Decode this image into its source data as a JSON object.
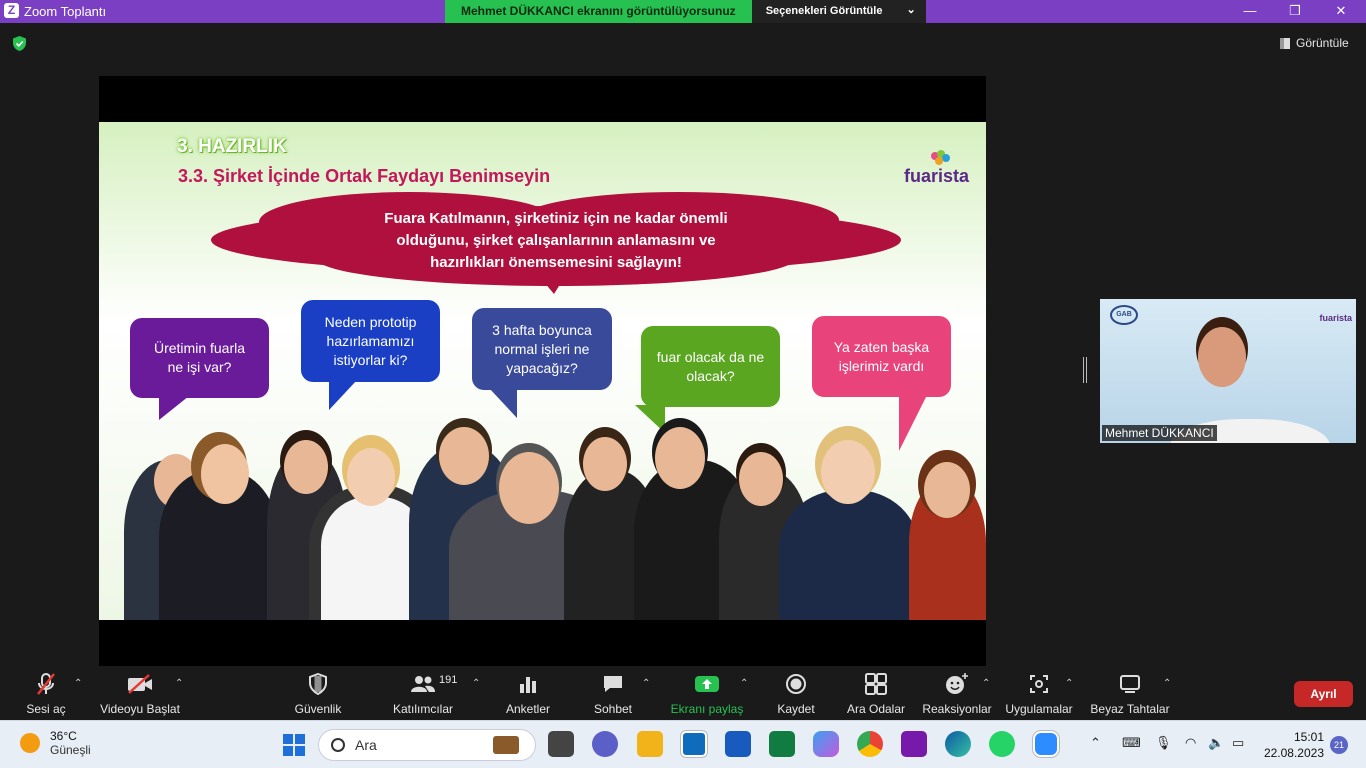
{
  "window": {
    "title": "Zoom Toplantı"
  },
  "share_banner": {
    "message": "Mehmet DÜKKANCI ekranını görüntülüyorsunuz",
    "options_label": "Seçenekleri Görüntüle"
  },
  "view_button": {
    "label": "Görüntüle"
  },
  "slide": {
    "heading": "3. HAZIRLIK",
    "subheading": "3.3. Şirket İçinde Ortak Faydayı Benimseyin",
    "logo_text": "fuarista",
    "cloud_lines": [
      "Fuara Katılmanın, şirketiniz için ne kadar önemli",
      "olduğunu,  şirket çalışanlarının anlamasını ve",
      "hazırlıkları önemsemesini sağlayın!"
    ],
    "bubbles": [
      {
        "lines": [
          "Üretimin fuarla",
          "ne işi var?"
        ],
        "color": "#6a1b9a"
      },
      {
        "lines": [
          "Neden prototip",
          "hazırlamamızı",
          "istiyorlar ki?"
        ],
        "color": "#1a3fc4"
      },
      {
        "lines": [
          "3 hafta boyunca",
          "normal işleri ne",
          "yapacağız?"
        ],
        "color": "#3a4a9a"
      },
      {
        "lines": [
          "fuar olacak da ne",
          "olacak?"
        ],
        "color": "#5aa620"
      },
      {
        "lines": [
          "Ya zaten başka",
          "işlerimiz vardı"
        ],
        "color": "#e8437a"
      }
    ]
  },
  "video": {
    "name": "Mehmet DÜKKANCI",
    "brand": "fuarista",
    "org_logo": "GAB"
  },
  "toolbar": {
    "mute": "Sesi aç",
    "video": "Videoyu Başlat",
    "security": "Güvenlik",
    "participants": "Katılımcılar",
    "participants_count": "191",
    "polls": "Anketler",
    "chat": "Sohbet",
    "share": "Ekranı paylaş",
    "record": "Kaydet",
    "rooms": "Ara Odalar",
    "reactions": "Reaksiyonlar",
    "apps": "Uygulamalar",
    "whiteboard": "Beyaz Tahtalar",
    "leave": "Ayrıl"
  },
  "taskbar": {
    "temp": "36°C",
    "weather": "Güneşli",
    "search_placeholder": "Ara",
    "time": "15:01",
    "date": "22.08.2023",
    "notifications": "21"
  },
  "colors": {
    "zoom_purple": "#7b3fc4",
    "share_green": "#27c151",
    "leave_red": "#c62828",
    "accent_pink": "#c2185b"
  }
}
